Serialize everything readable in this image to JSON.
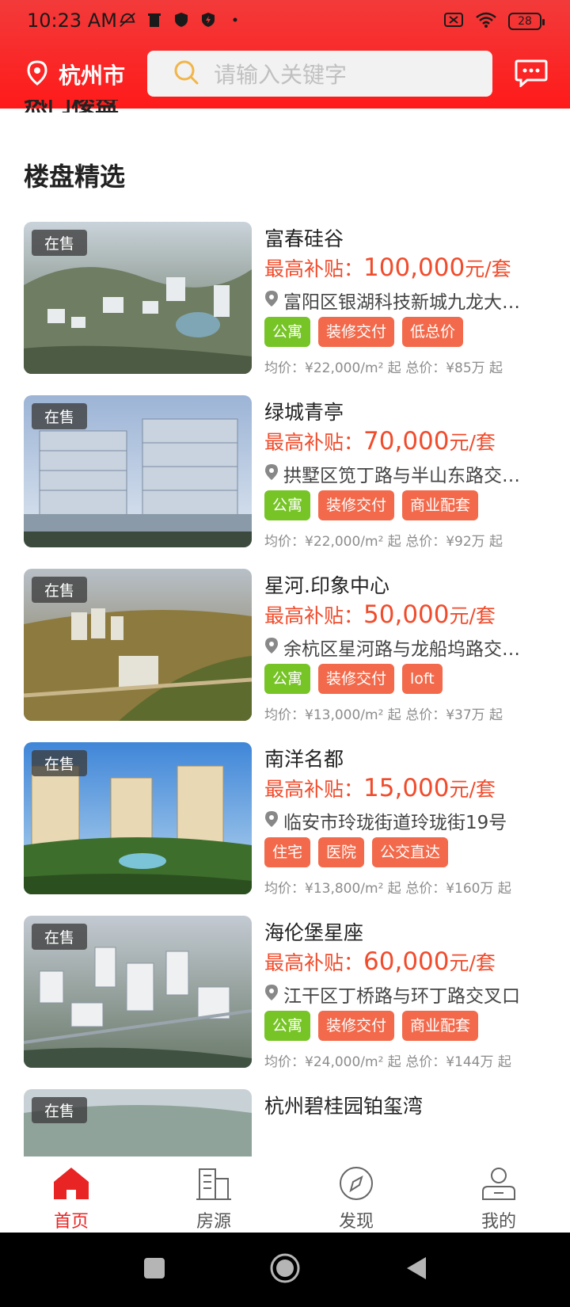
{
  "status_bar": {
    "time": "10:23 AM",
    "battery": "28"
  },
  "header": {
    "city": "杭州市",
    "search_placeholder": "请输入关键字"
  },
  "cutoff_text": "热门楼盘",
  "section_title": "楼盘精选",
  "listings": [
    {
      "badge": "在售",
      "name": "富春硅谷",
      "subsidy_label": "最高补贴：",
      "subsidy_value": "100,000",
      "subsidy_unit": "元/套",
      "address": "富阳区银湖科技新城九龙大道与…",
      "tags": [
        {
          "text": "公寓",
          "color": "green"
        },
        {
          "text": "装修交付",
          "color": "red"
        },
        {
          "text": "低总价",
          "color": "red"
        }
      ],
      "meta": "均价：¥22,000/m² 起  总价：¥85万 起"
    },
    {
      "badge": "在售",
      "name": "绿城青亭",
      "subsidy_label": "最高补贴：",
      "subsidy_value": "70,000",
      "subsidy_unit": "元/套",
      "address": "拱墅区笕丁路与半山东路交界处…",
      "tags": [
        {
          "text": "公寓",
          "color": "green"
        },
        {
          "text": "装修交付",
          "color": "red"
        },
        {
          "text": "商业配套",
          "color": "red"
        }
      ],
      "meta": "均价：¥22,000/m² 起  总价：¥92万 起"
    },
    {
      "badge": "在售",
      "name": "星河.印象中心",
      "subsidy_label": "最高补贴：",
      "subsidy_value": "50,000",
      "subsidy_unit": "元/套",
      "address": "余杭区星河路与龙船坞路交叉口…",
      "tags": [
        {
          "text": "公寓",
          "color": "green"
        },
        {
          "text": "装修交付",
          "color": "red"
        },
        {
          "text": "loft",
          "color": "red"
        }
      ],
      "meta": "均价：¥13,000/m² 起  总价：¥37万 起"
    },
    {
      "badge": "在售",
      "name": "南洋名都",
      "subsidy_label": "最高补贴：",
      "subsidy_value": "15,000",
      "subsidy_unit": "元/套",
      "address": "临安市玲珑街道玲珑街19号",
      "tags": [
        {
          "text": "住宅",
          "color": "red"
        },
        {
          "text": "医院",
          "color": "red"
        },
        {
          "text": "公交直达",
          "color": "red"
        }
      ],
      "meta": "均价：¥13,800/m² 起  总价：¥160万 起"
    },
    {
      "badge": "在售",
      "name": "海伦堡星座",
      "subsidy_label": "最高补贴：",
      "subsidy_value": "60,000",
      "subsidy_unit": "元/套",
      "address": "江干区丁桥路与环丁路交叉口",
      "tags": [
        {
          "text": "公寓",
          "color": "green"
        },
        {
          "text": "装修交付",
          "color": "red"
        },
        {
          "text": "商业配套",
          "color": "red"
        }
      ],
      "meta": "均价：¥24,000/m² 起  总价：¥144万 起"
    },
    {
      "badge": "在售",
      "name": "杭州碧桂园铂玺湾",
      "subsidy_label": "",
      "subsidy_value": "",
      "subsidy_unit": "",
      "address": "",
      "tags": [],
      "meta": ""
    }
  ],
  "tabs": [
    {
      "label": "首页",
      "icon": "home-icon",
      "active": true
    },
    {
      "label": "房源",
      "icon": "building-icon",
      "active": false
    },
    {
      "label": "发现",
      "icon": "compass-icon",
      "active": false
    },
    {
      "label": "我的",
      "icon": "user-icon",
      "active": false
    }
  ],
  "colors": {
    "brand_red": "#e82424",
    "price": "#f04c2c",
    "tag_green": "#76c426",
    "tag_red": "#f26a4b"
  }
}
